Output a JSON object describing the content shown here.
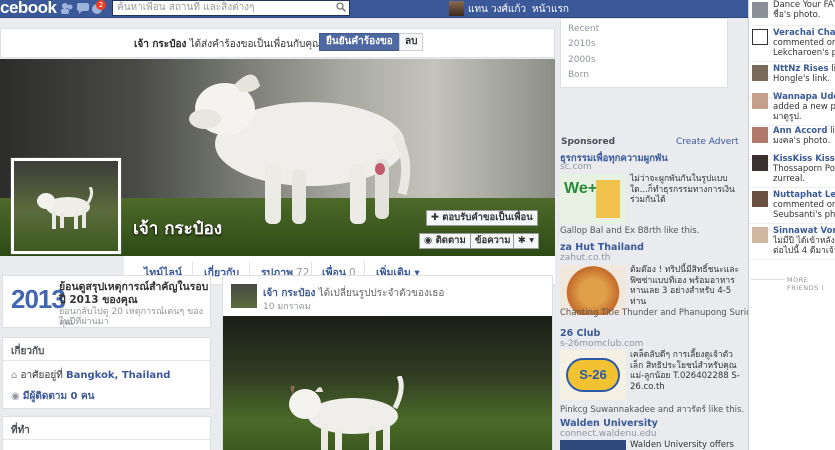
{
  "topbar": {
    "logo": "cebook",
    "notification_count": "2",
    "search_placeholder": "ค้นหาเพื่อน สถานที่ และสิ่งต่างๆ",
    "user_name": "แทน วงศ์แก้ว",
    "home_label": "หน้าแรก"
  },
  "friend_banner": {
    "name": "เจ้า กระป๋อง",
    "text": " ได้ส่งคำร้องขอเป็นเพื่อนกับคุณ",
    "confirm": "ยืนยันคำร้องขอ",
    "delete": "ลบ"
  },
  "profile": {
    "name": "เจ้า กระป๋อง",
    "respond_button": "ตอบรับคำขอเป็นเพื่อน",
    "follow_button": "ติดตาม",
    "message_button": "ข้อความ",
    "gear_glyph": "✱ ▾"
  },
  "tabs": [
    {
      "label": "ไทม์ไลน์"
    },
    {
      "label": "เกี่ยวกับ"
    },
    {
      "label": "รูปภาพ",
      "count": "72"
    },
    {
      "label": "เพื่อน",
      "count": "0"
    },
    {
      "label": "เพิ่มเติม ▾"
    }
  ],
  "year_review": {
    "year": "2013",
    "title": "ย้อนดูสรุปเหตุการณ์สำคัญในรอบปี 2013 ของคุณ",
    "subtitle_line1": "ย้อนกลับไปดู 20 เหตุการณ์เด่นๆ ของคุณ",
    "subtitle_line2": "ในปีที่ผ่านมา"
  },
  "about": {
    "heading": "เกี่ยวกับ",
    "lives_prefix": "อาศัยอยู่ที่ ",
    "lives_place": "Bangkok, Thailand",
    "followers": "มีผู้ติดตาม 0 คน"
  },
  "friends_section": {
    "heading": "ที่ทำ"
  },
  "post": {
    "name": "เจ้า กระป๋อง",
    "action": " ได้เปลี่ยนรูปประจำตัวของเธอ",
    "date": "10 มกราคม"
  },
  "years_nav": [
    "Recent",
    "2010s",
    "2000s",
    "Born"
  ],
  "ads": {
    "heading": "Sponsored",
    "create": "Create Advert",
    "items": [
      {
        "title": "ธุรกรรมเพื่อทุกความผูกพัน",
        "url": "sc.com",
        "desc": "ไม่ว่าจะผูกพันกันในรูปแบบใด...ก็ทำธุรกรรมทางการเงินร่วมกันได้",
        "like": "Gallop Bal and Ex B8rth like this.",
        "img_label": "We+"
      },
      {
        "title": "za Hut Thailand",
        "url": "zahut.co.th",
        "desc": "ต้มต๊อง ! ทริปนี้มีสิทธิ์ชนะและฟิซซ่าแบบทีเอง พร้อมอาหารหานเลย 3 อย่างสำหรับ 4-5 ท่าน",
        "like": "Chanting Title Thunder and Phanupong Surichai like this.",
        "img_label": ""
      },
      {
        "title": "26 Club",
        "url": "s-26momclub.com",
        "desc": "เคล็ดลับดีๆ การเลี้ยงดูเจ้าตัวเล็ก สิทธิประโยชน์สำหรับคุณแม่-ลูกน้อย T.026402288 S-26.co.th",
        "like": "Pinkcg Suwannakadee and สาวรัตร์ like this.",
        "img_label": "S-26"
      },
      {
        "title": "Walden University",
        "url": "connect.waldenu.edu",
        "desc": "Walden University offers",
        "like": "",
        "img_label": ""
      }
    ]
  },
  "ticker": [
    {
      "name": "",
      "line1": "Dance Your FAT O",
      "line2": "ชื่อ's photo."
    },
    {
      "name": "Verachai Chanth",
      "line1": "commented on Nu",
      "line2": "Lekcharoen's post."
    },
    {
      "name": "NttNz Rises",
      "line1": "like",
      "line2": "Hongle's link."
    },
    {
      "name": "Wannapa Udomv",
      "line1": "added a new photo",
      "line2": "มาดูรูป."
    },
    {
      "name": "Ann Accord",
      "line1": "likes",
      "line2": "มงคล's photo."
    },
    {
      "name": "KissKiss Kissend",
      "line1": "Thossaporn Poonm",
      "line2": "zurreal."
    },
    {
      "name": "Nuttaphat Lekch",
      "line1": "commented on Pra",
      "line2": "Seubsanti's photo:"
    },
    {
      "name": "Sinnawat Vorasit",
      "line1": "ไม่มีปี ได้เข้าหลังเลิ",
      "line2": "ต่อไปนี้ 4 ดีมาเจ้าอ้า"
    }
  ],
  "ticker_more": "MORE FRIENDS (",
  "colors": {
    "brand": "#3b5998",
    "button_blue": "#4e69a2",
    "page_bg": "#e9ebee"
  }
}
